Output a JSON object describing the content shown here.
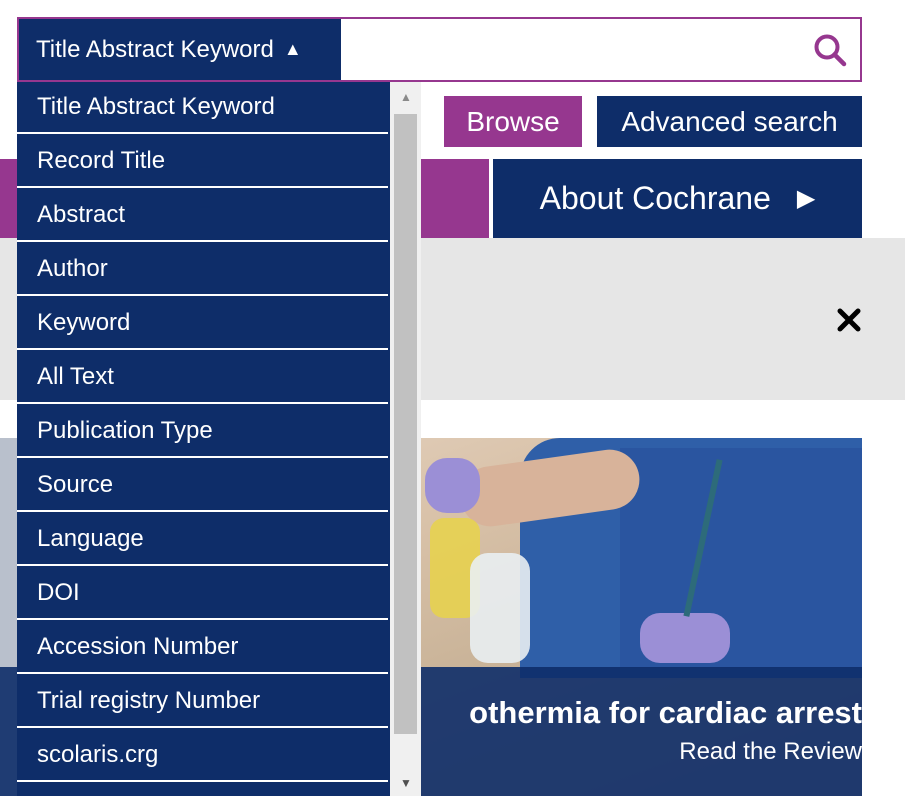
{
  "search": {
    "selected_field": "Title Abstract Keyword",
    "placeholder": "",
    "value": ""
  },
  "dropdown": {
    "options": [
      "Title Abstract Keyword",
      "Record Title",
      "Abstract",
      "Author",
      "Keyword",
      "All Text",
      "Publication Type",
      "Source",
      "Language",
      "DOI",
      "Accession Number",
      "Trial registry Number",
      "scolaris.crg"
    ]
  },
  "buttons": {
    "browse": "Browse",
    "advanced_search": "Advanced search"
  },
  "nav": {
    "about": "About Cochrane"
  },
  "hero": {
    "title": "othermia for cardiac arrest",
    "link": "Read the Review"
  },
  "colors": {
    "navy": "#0e2d69",
    "purple": "#96378f",
    "banner_grey": "#e6e6e6"
  }
}
